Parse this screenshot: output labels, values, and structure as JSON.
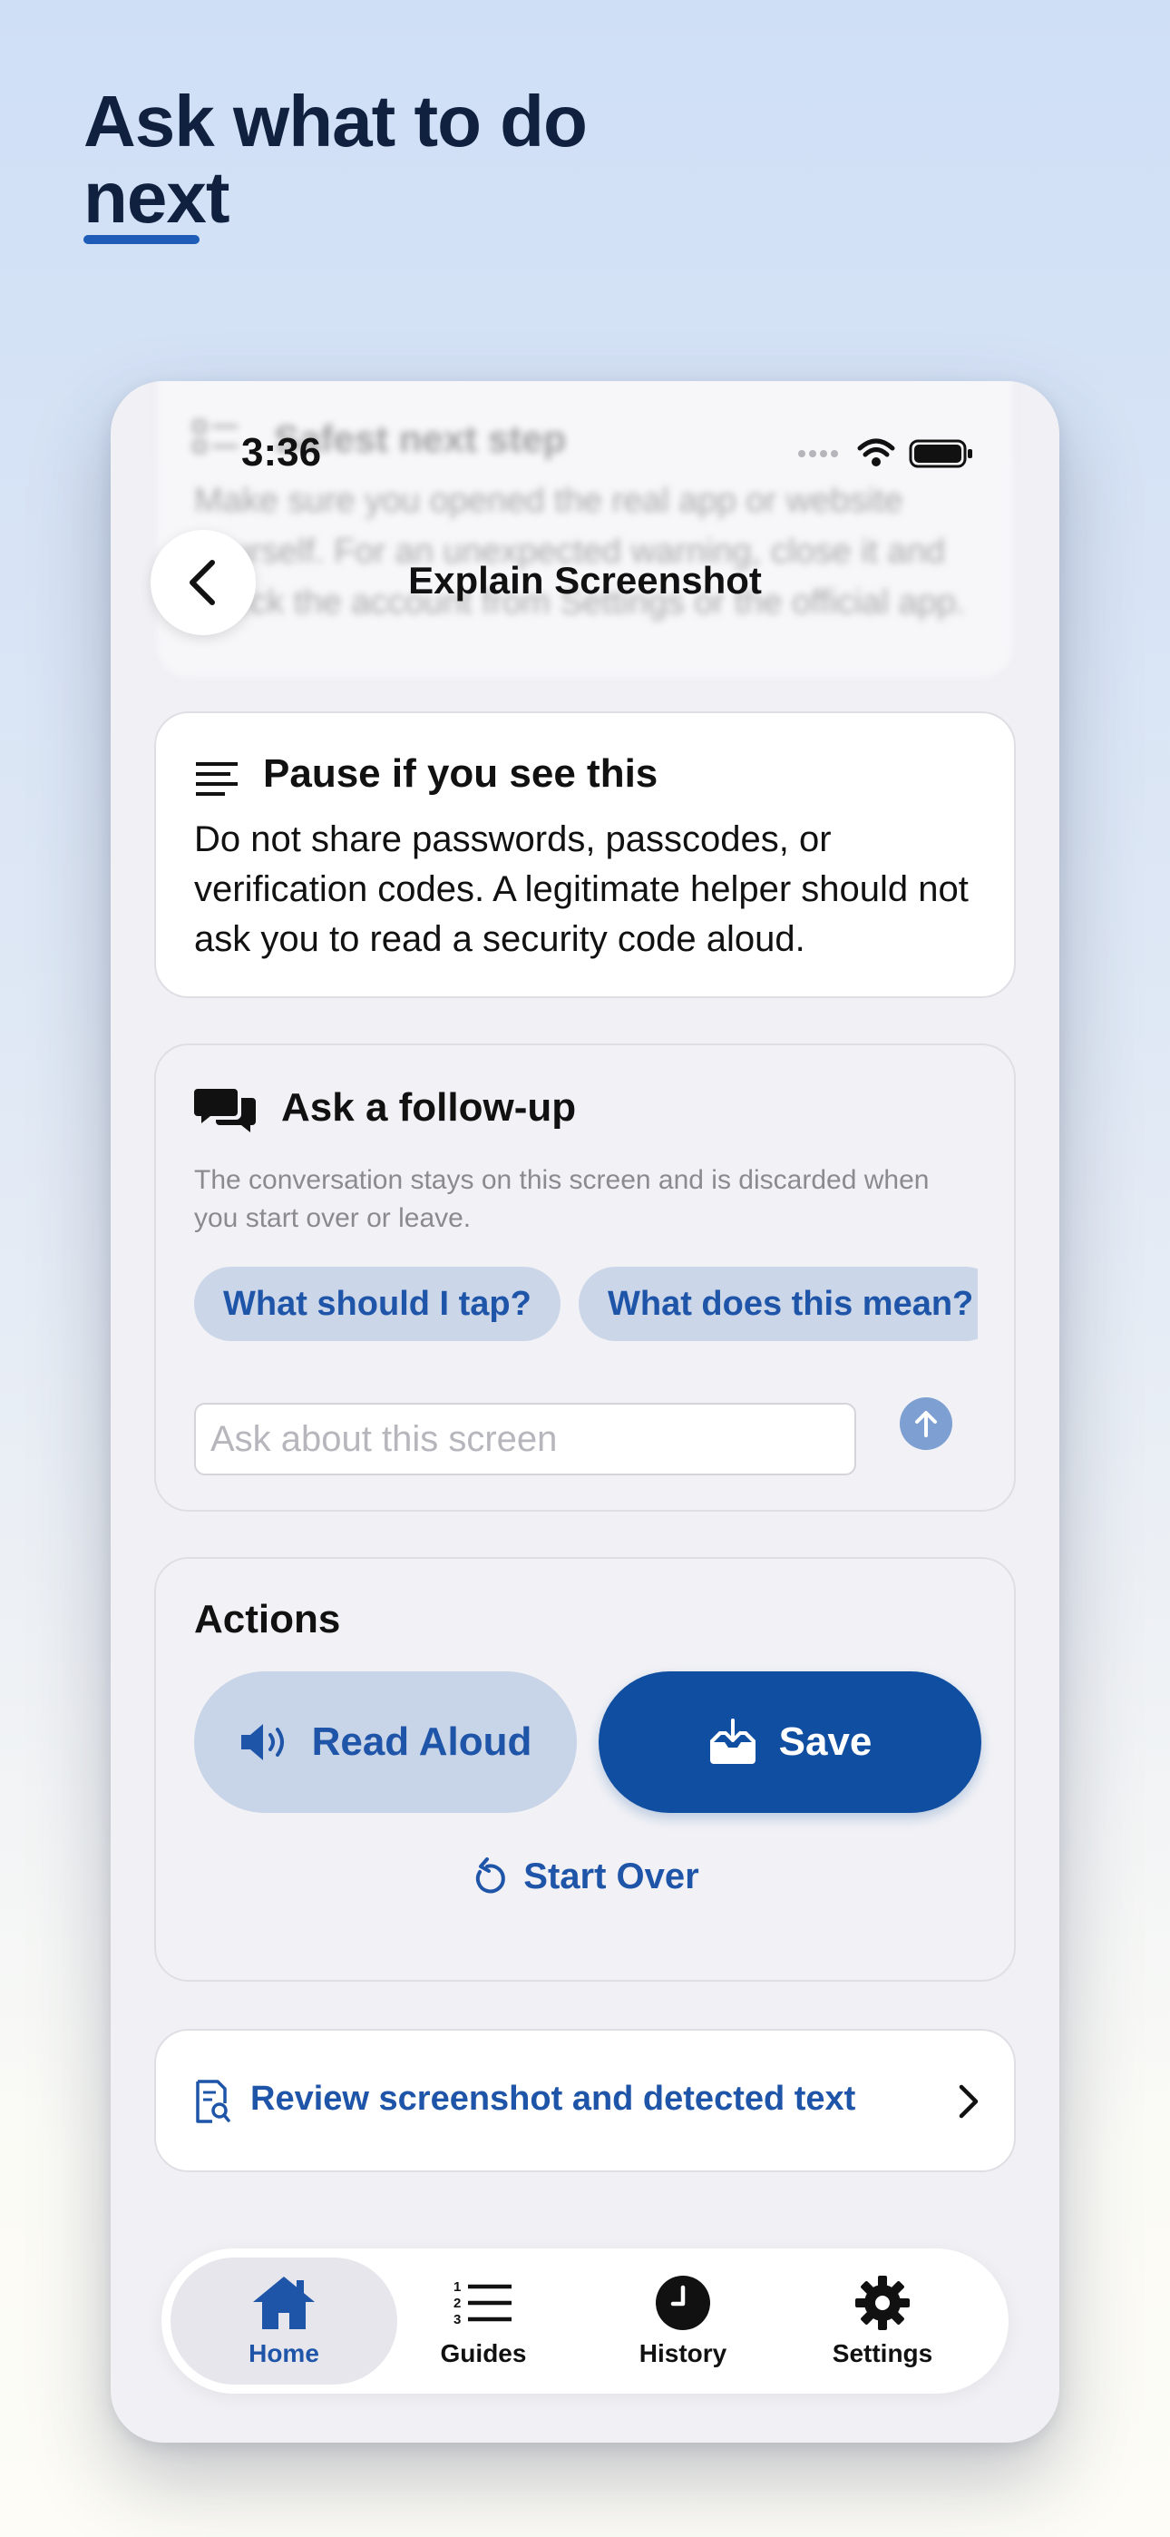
{
  "headline": {
    "line1": "Ask what to do",
    "line2": "next"
  },
  "status_bar": {
    "time": "3:36"
  },
  "nav": {
    "title": "Explain Screenshot"
  },
  "blurred_card": {
    "title": "Safest next step",
    "body": "Make sure you opened the real app or website yourself. For an unexpected warning, close it and check the account from Settings or the official app."
  },
  "pause_card": {
    "title": "Pause if you see this",
    "body": "Do not share passwords, passcodes, or verification codes. A legitimate helper should not ask you to read a security code aloud."
  },
  "followup_card": {
    "title": "Ask a follow-up",
    "description": "The conversation stays on this screen and is discarded when you start over or leave.",
    "chips": [
      "What should I tap?",
      "What does this mean?"
    ],
    "input_placeholder": "Ask about this screen",
    "input_value": ""
  },
  "actions_card": {
    "title": "Actions",
    "read_aloud_label": "Read Aloud",
    "save_label": "Save",
    "start_over_label": "Start Over"
  },
  "review_row": {
    "label": "Review screenshot and detected text"
  },
  "tabs": [
    {
      "label": "Home",
      "icon": "house-icon",
      "active": true
    },
    {
      "label": "Guides",
      "icon": "numbered-list-icon",
      "active": false
    },
    {
      "label": "History",
      "icon": "clock-icon",
      "active": false
    },
    {
      "label": "Settings",
      "icon": "gear-icon",
      "active": false
    }
  ],
  "colors": {
    "accent": "#1f55a8",
    "primary_button": "#0f4ea0",
    "chip_bg": "#cbd7e9",
    "headline": "#10213f"
  }
}
